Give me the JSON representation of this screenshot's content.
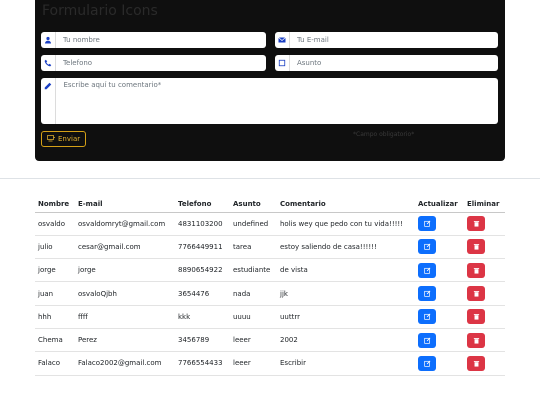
{
  "form": {
    "title": "Formulario Icons",
    "name_placeholder": "Tu nombre",
    "email_placeholder": "Tu E-mail",
    "phone_placeholder": "Telefono",
    "subject_placeholder": "Asunto",
    "comment_placeholder": "Escribe aquí tu comentario*",
    "send_label": "Enviar",
    "required_note": "*Campo obligatorio*"
  },
  "table": {
    "headers": [
      "Nombre",
      "E-mail",
      "Telefono",
      "Asunto",
      "Comentario",
      "Actualizar",
      "Eliminar"
    ],
    "rows": [
      [
        "osvaldo",
        "osvaldomryt@gmail.com",
        "4831103200",
        "undefined",
        "holis wey que pedo con tu vida!!!!!"
      ],
      [
        "julio",
        "cesar@gmail.com",
        "7766449911",
        "tarea",
        "estoy saliendo de casa!!!!!!"
      ],
      [
        "jorge",
        "jorge",
        "8890654922",
        "estudiante",
        "de vista"
      ],
      [
        "juan",
        "osvaloQjbh",
        "3654476",
        "nada",
        "jjk"
      ],
      [
        "hhh",
        "ffff",
        "kkk",
        "uuuu",
        "uuttrr"
      ],
      [
        "Chema",
        "Perez",
        "3456789",
        "leeer",
        "2002"
      ],
      [
        "Falaco",
        "Falaco2002@gmail.com",
        "7766554433",
        "leeer",
        "Escribir"
      ]
    ]
  },
  "colors": {
    "edit": "#0d6efd",
    "delete": "#dc3545",
    "send_accent": "#d4a017",
    "icon_blue": "#1a3fc4"
  }
}
